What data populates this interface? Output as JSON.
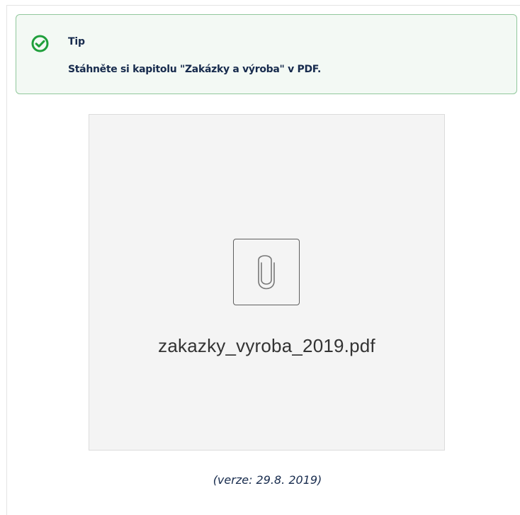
{
  "tip": {
    "icon": "check-circle-icon",
    "title": "Tip",
    "text": "Stáhněte si kapitolu \"Zakázky a výroba\" v PDF."
  },
  "attachment": {
    "icon": "paperclip-icon",
    "filename": "zakazky_vyroba_2019.pdf"
  },
  "version_note": "(verze: 29.8. 2019)",
  "colors": {
    "tip_background": "#f3f9f4",
    "tip_border": "#91c89c",
    "tip_icon": "#1f9f3b",
    "attachment_background": "#f4f4f4",
    "text": "#172b4d"
  }
}
